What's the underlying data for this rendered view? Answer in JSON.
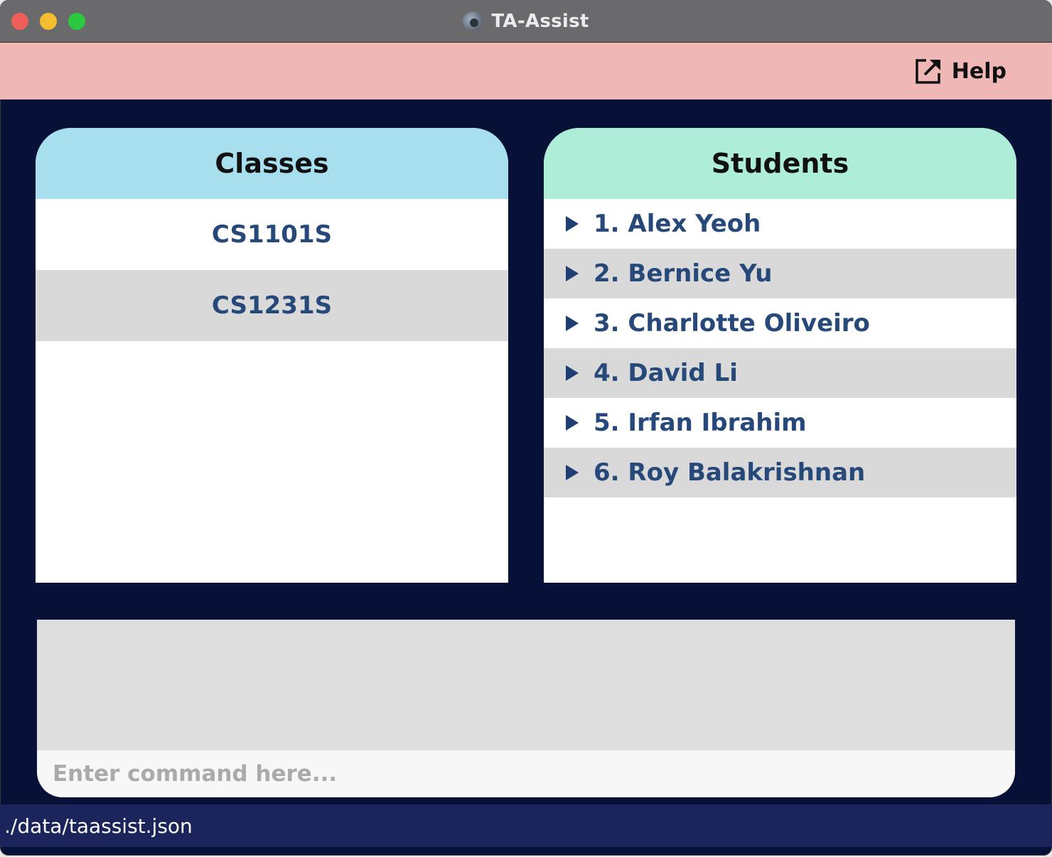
{
  "window": {
    "title": "TA-Assist"
  },
  "menubar": {
    "help_label": "Help"
  },
  "classes_panel": {
    "title": "Classes",
    "items": [
      "CS1101S",
      "CS1231S"
    ]
  },
  "students_panel": {
    "title": "Students",
    "items": [
      "1. Alex Yeoh",
      "2. Bernice Yu",
      "3. Charlotte Oliveiro",
      "4. David Li",
      "5. Irfan Ibrahim",
      "6. Roy Balakrishnan"
    ]
  },
  "command": {
    "result_text": "",
    "placeholder": "Enter command here...",
    "value": ""
  },
  "status_bar": {
    "path": "./data/taassist.json"
  },
  "colors": {
    "menubar": "#efb8b7",
    "classes_header": "#a7dfef",
    "students_header": "#aeeed8",
    "background": "#071037",
    "status_bar": "#1b255c",
    "item_text": "#27497a"
  },
  "icons": {
    "help": "external-link-icon",
    "expand": "triangle-right-icon"
  }
}
